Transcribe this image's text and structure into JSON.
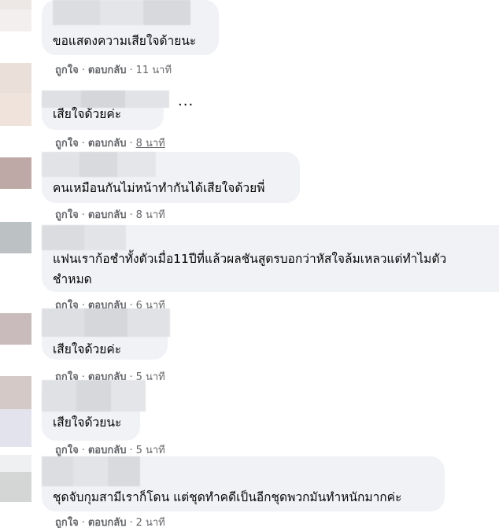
{
  "comments": [
    {
      "text_lines": [
        "ขอแสดงความเสียใจด้ายนะ"
      ],
      "actions": {
        "like": "ถูกใจ",
        "separator": "·",
        "reply": "ตอบกลับ",
        "time": "11 นาที"
      }
    },
    {
      "text_lines": [
        "เสียใจด้วยค่ะ"
      ],
      "more_dots": "...",
      "actions": {
        "like": "ถูกใจ",
        "separator": "·",
        "reply": "ตอบกลับ",
        "time": "8 นาที"
      }
    },
    {
      "text_lines": [
        "คนเหมือนกันไม่หน้าทำกันได้เสียใจด้วยพี่"
      ],
      "actions": {
        "like": "ถูกใจ",
        "separator": "·",
        "reply": "ตอบกลับ",
        "time": "8 นาที"
      }
    },
    {
      "text_lines": [
        "แฟนเราก้อชำทั้งตัวเมื่อ11ปีที่แล้วผลชันสูตรบอกว่าหัสใจล้มเหลวแต่ทำไมตัว",
        "ชำหมด"
      ],
      "actions": {
        "like": "ถูกใจ",
        "separator": "·",
        "reply": "ตอบกลับ",
        "time": "6 นาที"
      }
    },
    {
      "text_lines": [
        "เสียใจด้วยค่ะ"
      ],
      "actions": {
        "like": "ถูกใจ",
        "separator": "·",
        "reply": "ตอบกลับ",
        "time": "5 นาที"
      }
    },
    {
      "text_lines": [
        "เสียใจด้วยนะ"
      ],
      "actions": {
        "like": "ถูกใจ",
        "separator": "·",
        "reply": "ตอบกลับ",
        "time": "5 นาที"
      }
    },
    {
      "text_lines": [
        "ชุดจับกุมสามีเราก็โดน แต่ชุดทำคดีเป็นอีกชุดพวกมันทำหนักมากค่ะ"
      ],
      "actions": {
        "like": "ถูกใจ",
        "separator": "·",
        "reply": "ตอบกลับ",
        "time": "2 นาที"
      }
    }
  ],
  "colors": {
    "bubble": "#f0f2f5",
    "text": "#050505",
    "meta": "#65676b"
  }
}
